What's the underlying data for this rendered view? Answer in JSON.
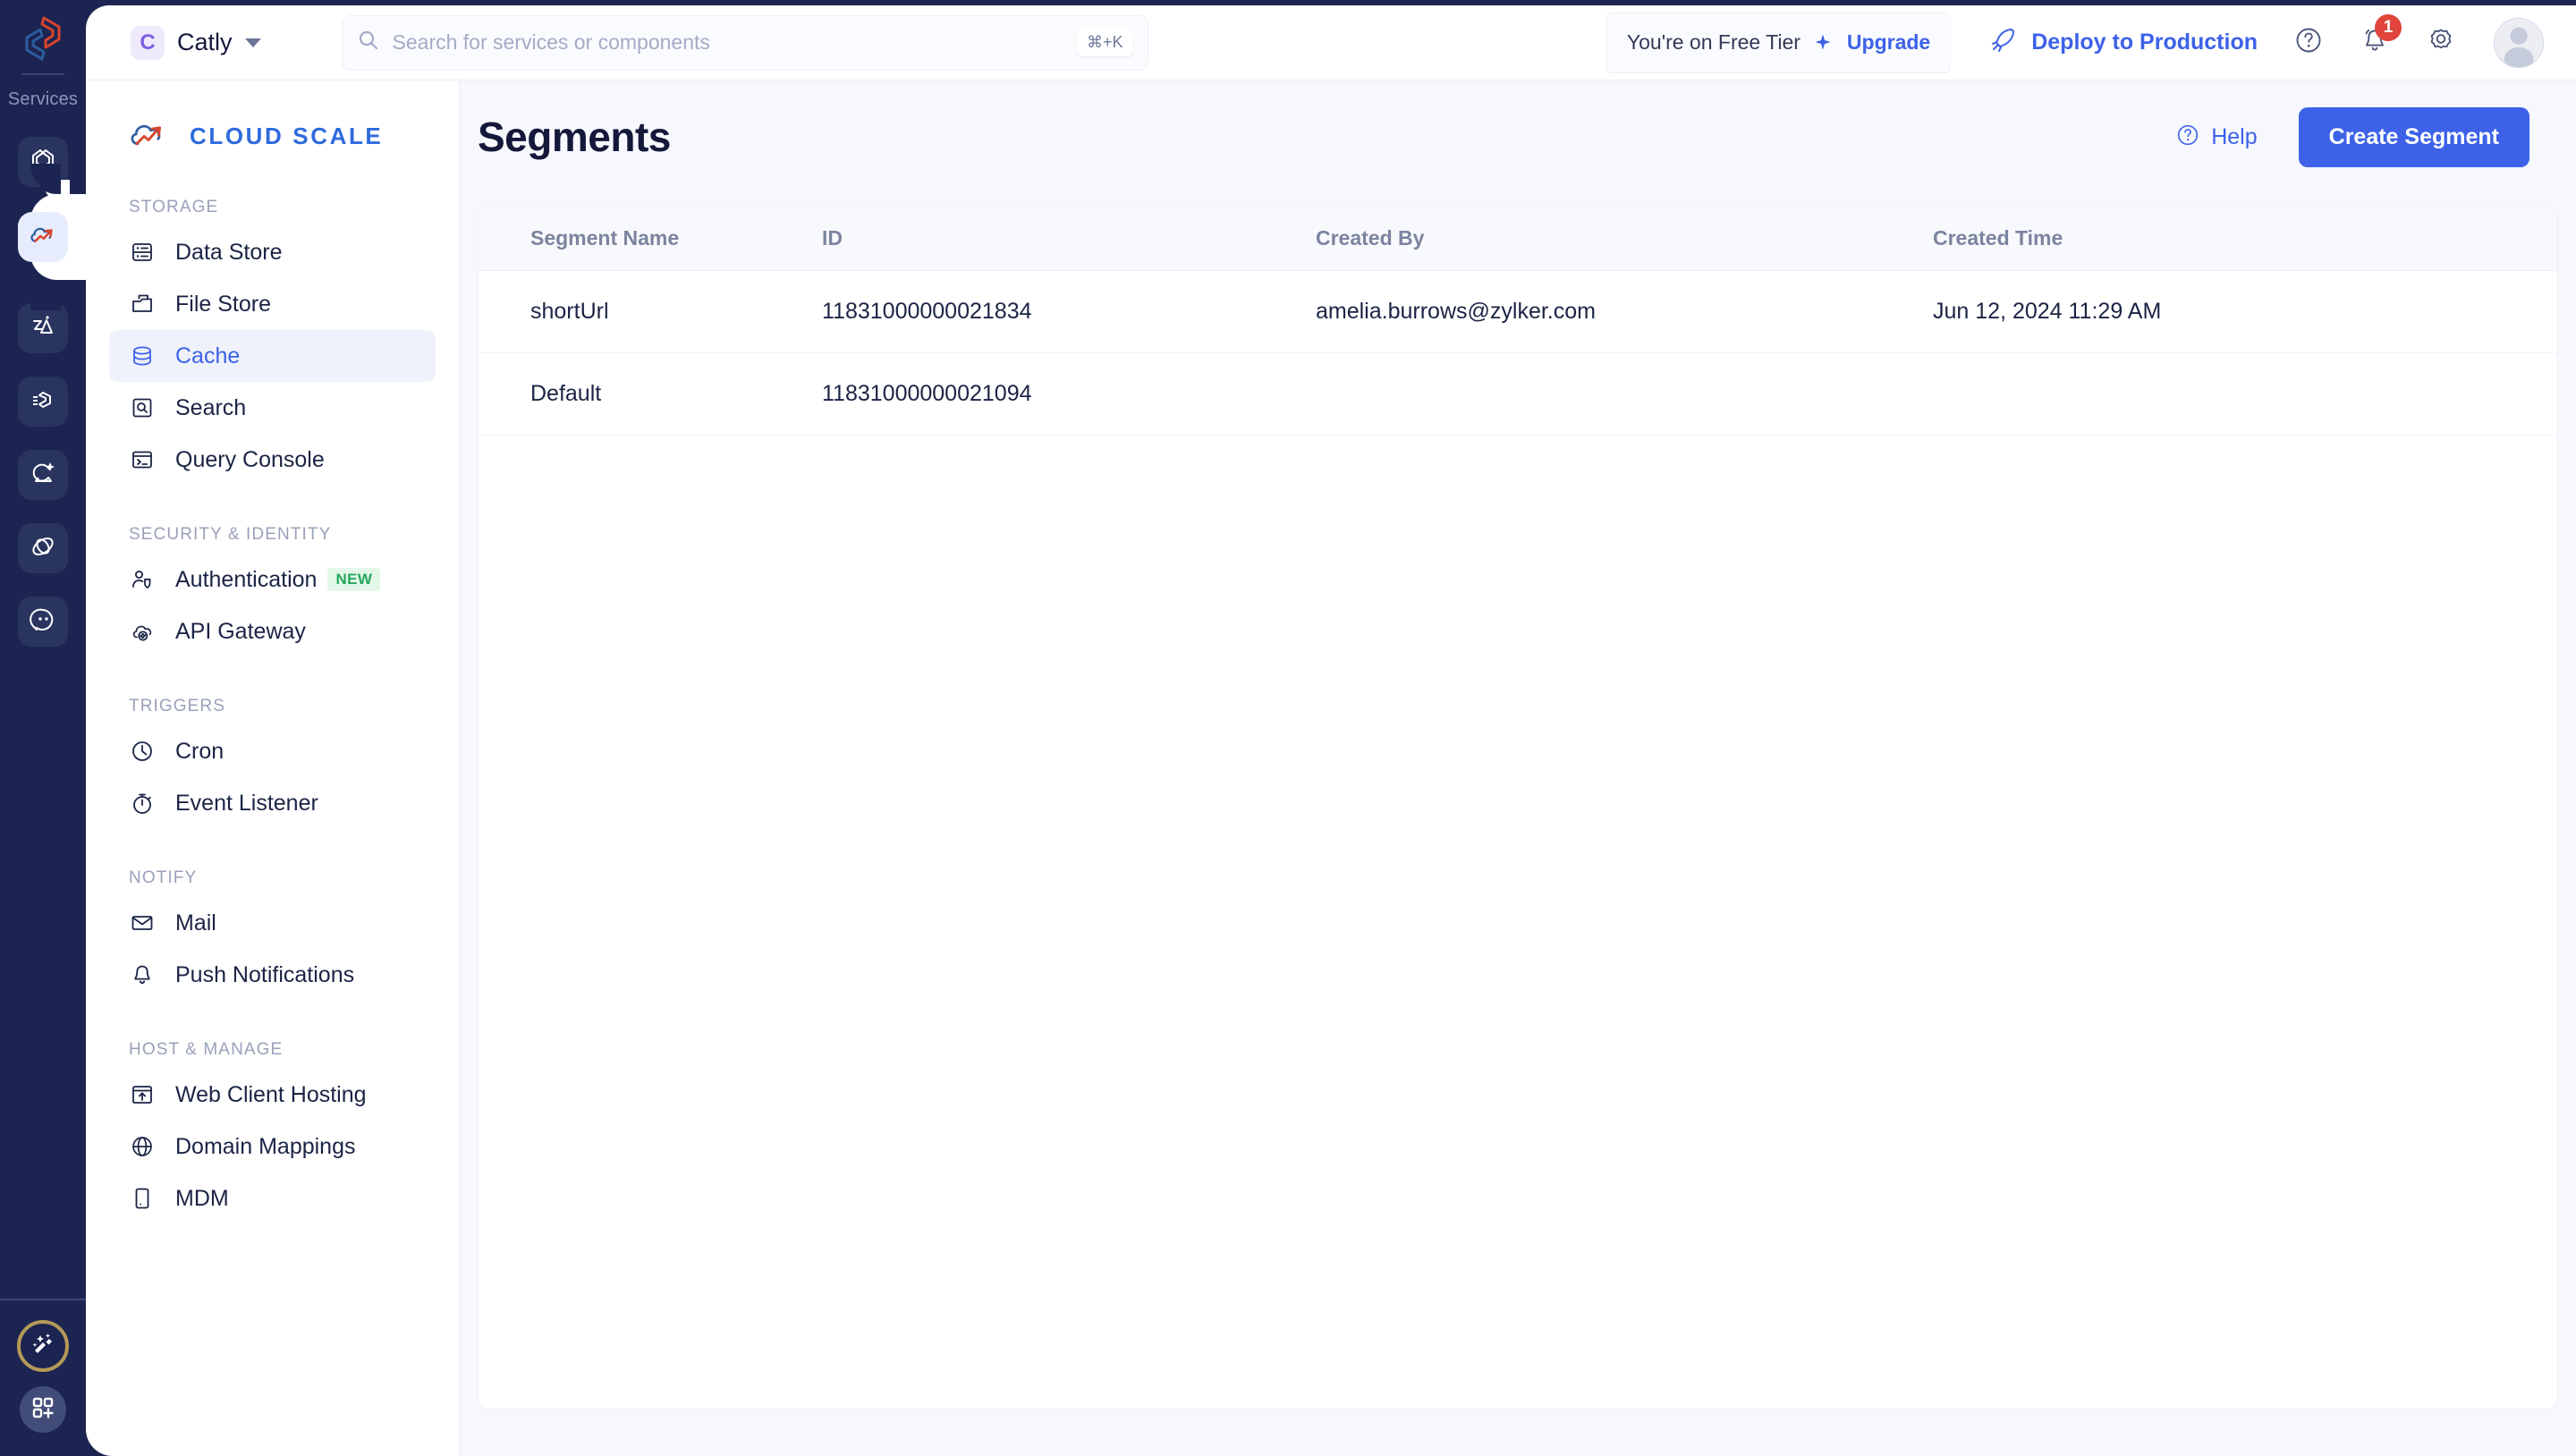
{
  "rail": {
    "services_label": "Services",
    "items": [
      {
        "name": "code-services-icon",
        "title": "Code Services"
      },
      {
        "name": "cloud-scale-icon",
        "title": "Cloud Scale",
        "active": true
      },
      {
        "name": "catalyst-icon",
        "title": "Catalyst"
      },
      {
        "name": "flow-icon",
        "title": "Flow"
      },
      {
        "name": "ai-assist-icon",
        "title": "AI Assist"
      },
      {
        "name": "orbit-icon",
        "title": "Orbit"
      },
      {
        "name": "chat-icon",
        "title": "Chat"
      }
    ],
    "bottom": [
      {
        "name": "magic-wand-icon",
        "title": "Magic"
      },
      {
        "name": "apps-grid-add-icon",
        "title": "Apps"
      }
    ]
  },
  "topbar": {
    "org": {
      "initial": "C",
      "name": "Catly"
    },
    "search": {
      "placeholder": "Search for services or components",
      "shortcut": "⌘+K",
      "value": ""
    },
    "tier": {
      "text": "You're on Free Tier",
      "upgrade_label": "Upgrade"
    },
    "deploy_label": "Deploy to Production",
    "notifications_count": "1"
  },
  "sidebar": {
    "brand": "CLOUD SCALE",
    "groups": [
      {
        "title": "STORAGE",
        "items": [
          {
            "label": "Data Store",
            "icon": "data-store-icon",
            "active": false
          },
          {
            "label": "File Store",
            "icon": "file-store-icon",
            "active": false
          },
          {
            "label": "Cache",
            "icon": "cache-icon",
            "active": true
          },
          {
            "label": "Search",
            "icon": "search-box-icon",
            "active": false
          },
          {
            "label": "Query Console",
            "icon": "query-console-icon",
            "active": false
          }
        ]
      },
      {
        "title": "SECURITY & IDENTITY",
        "items": [
          {
            "label": "Authentication",
            "icon": "user-shield-icon",
            "badge": "NEW",
            "active": false
          },
          {
            "label": "API Gateway",
            "icon": "api-gateway-icon",
            "active": false
          }
        ]
      },
      {
        "title": "TRIGGERS",
        "items": [
          {
            "label": "Cron",
            "icon": "clock-icon",
            "active": false
          },
          {
            "label": "Event Listener",
            "icon": "stopwatch-icon",
            "active": false
          }
        ]
      },
      {
        "title": "NOTIFY",
        "items": [
          {
            "label": "Mail",
            "icon": "mail-icon",
            "active": false
          },
          {
            "label": "Push Notifications",
            "icon": "bell-icon",
            "active": false
          }
        ]
      },
      {
        "title": "HOST & MANAGE",
        "items": [
          {
            "label": "Web Client Hosting",
            "icon": "web-hosting-icon",
            "active": false
          },
          {
            "label": "Domain Mappings",
            "icon": "globe-icon",
            "active": false
          },
          {
            "label": "MDM",
            "icon": "mobile-device-icon",
            "active": false
          }
        ]
      }
    ]
  },
  "page": {
    "title": "Segments",
    "help_label": "Help",
    "create_label": "Create Segment"
  },
  "table": {
    "columns": [
      "Segment Name",
      "ID",
      "Created By",
      "Created Time"
    ],
    "rows": [
      {
        "name": "shortUrl",
        "id": "11831000000021834",
        "created_by": "amelia.burrows@zylker.com",
        "created_time": "Jun 12, 2024 11:29 AM"
      },
      {
        "name": "Default",
        "id": "11831000000021094",
        "created_by": "",
        "created_time": ""
      }
    ]
  },
  "colors": {
    "accent": "#3d62e8",
    "rail_bg": "#1c2551",
    "main_bg": "#f7f8fd",
    "badge_green": "#26a75a",
    "badge_red": "#e0443b",
    "gold": "#b49a58"
  }
}
